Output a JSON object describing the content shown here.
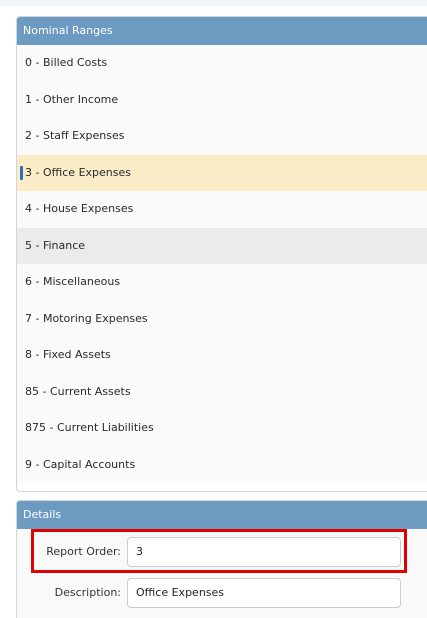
{
  "ranges": {
    "title": "Nominal Ranges",
    "items": [
      {
        "label": "0 - Billed Costs"
      },
      {
        "label": "1 - Other Income"
      },
      {
        "label": "2 - Staff Expenses"
      },
      {
        "label": "3 - Office Expenses",
        "selected": true
      },
      {
        "label": "4 - House Expenses"
      },
      {
        "label": "5 - Finance",
        "hovered": true
      },
      {
        "label": "6 - Miscellaneous"
      },
      {
        "label": "7 - Motoring Expenses"
      },
      {
        "label": "8 - Fixed Assets"
      },
      {
        "label": "85 - Current Assets"
      },
      {
        "label": "875 - Current Liabilities"
      },
      {
        "label": "9 - Capital Accounts"
      }
    ]
  },
  "details": {
    "title": "Details",
    "report_order_label": "Report Order:",
    "report_order_value": "3",
    "description_label": "Description:",
    "description_value": "Office Expenses"
  },
  "colors": {
    "header": "#6c9ac0",
    "selected": "#fbecc8",
    "highlight": "#e00000"
  }
}
